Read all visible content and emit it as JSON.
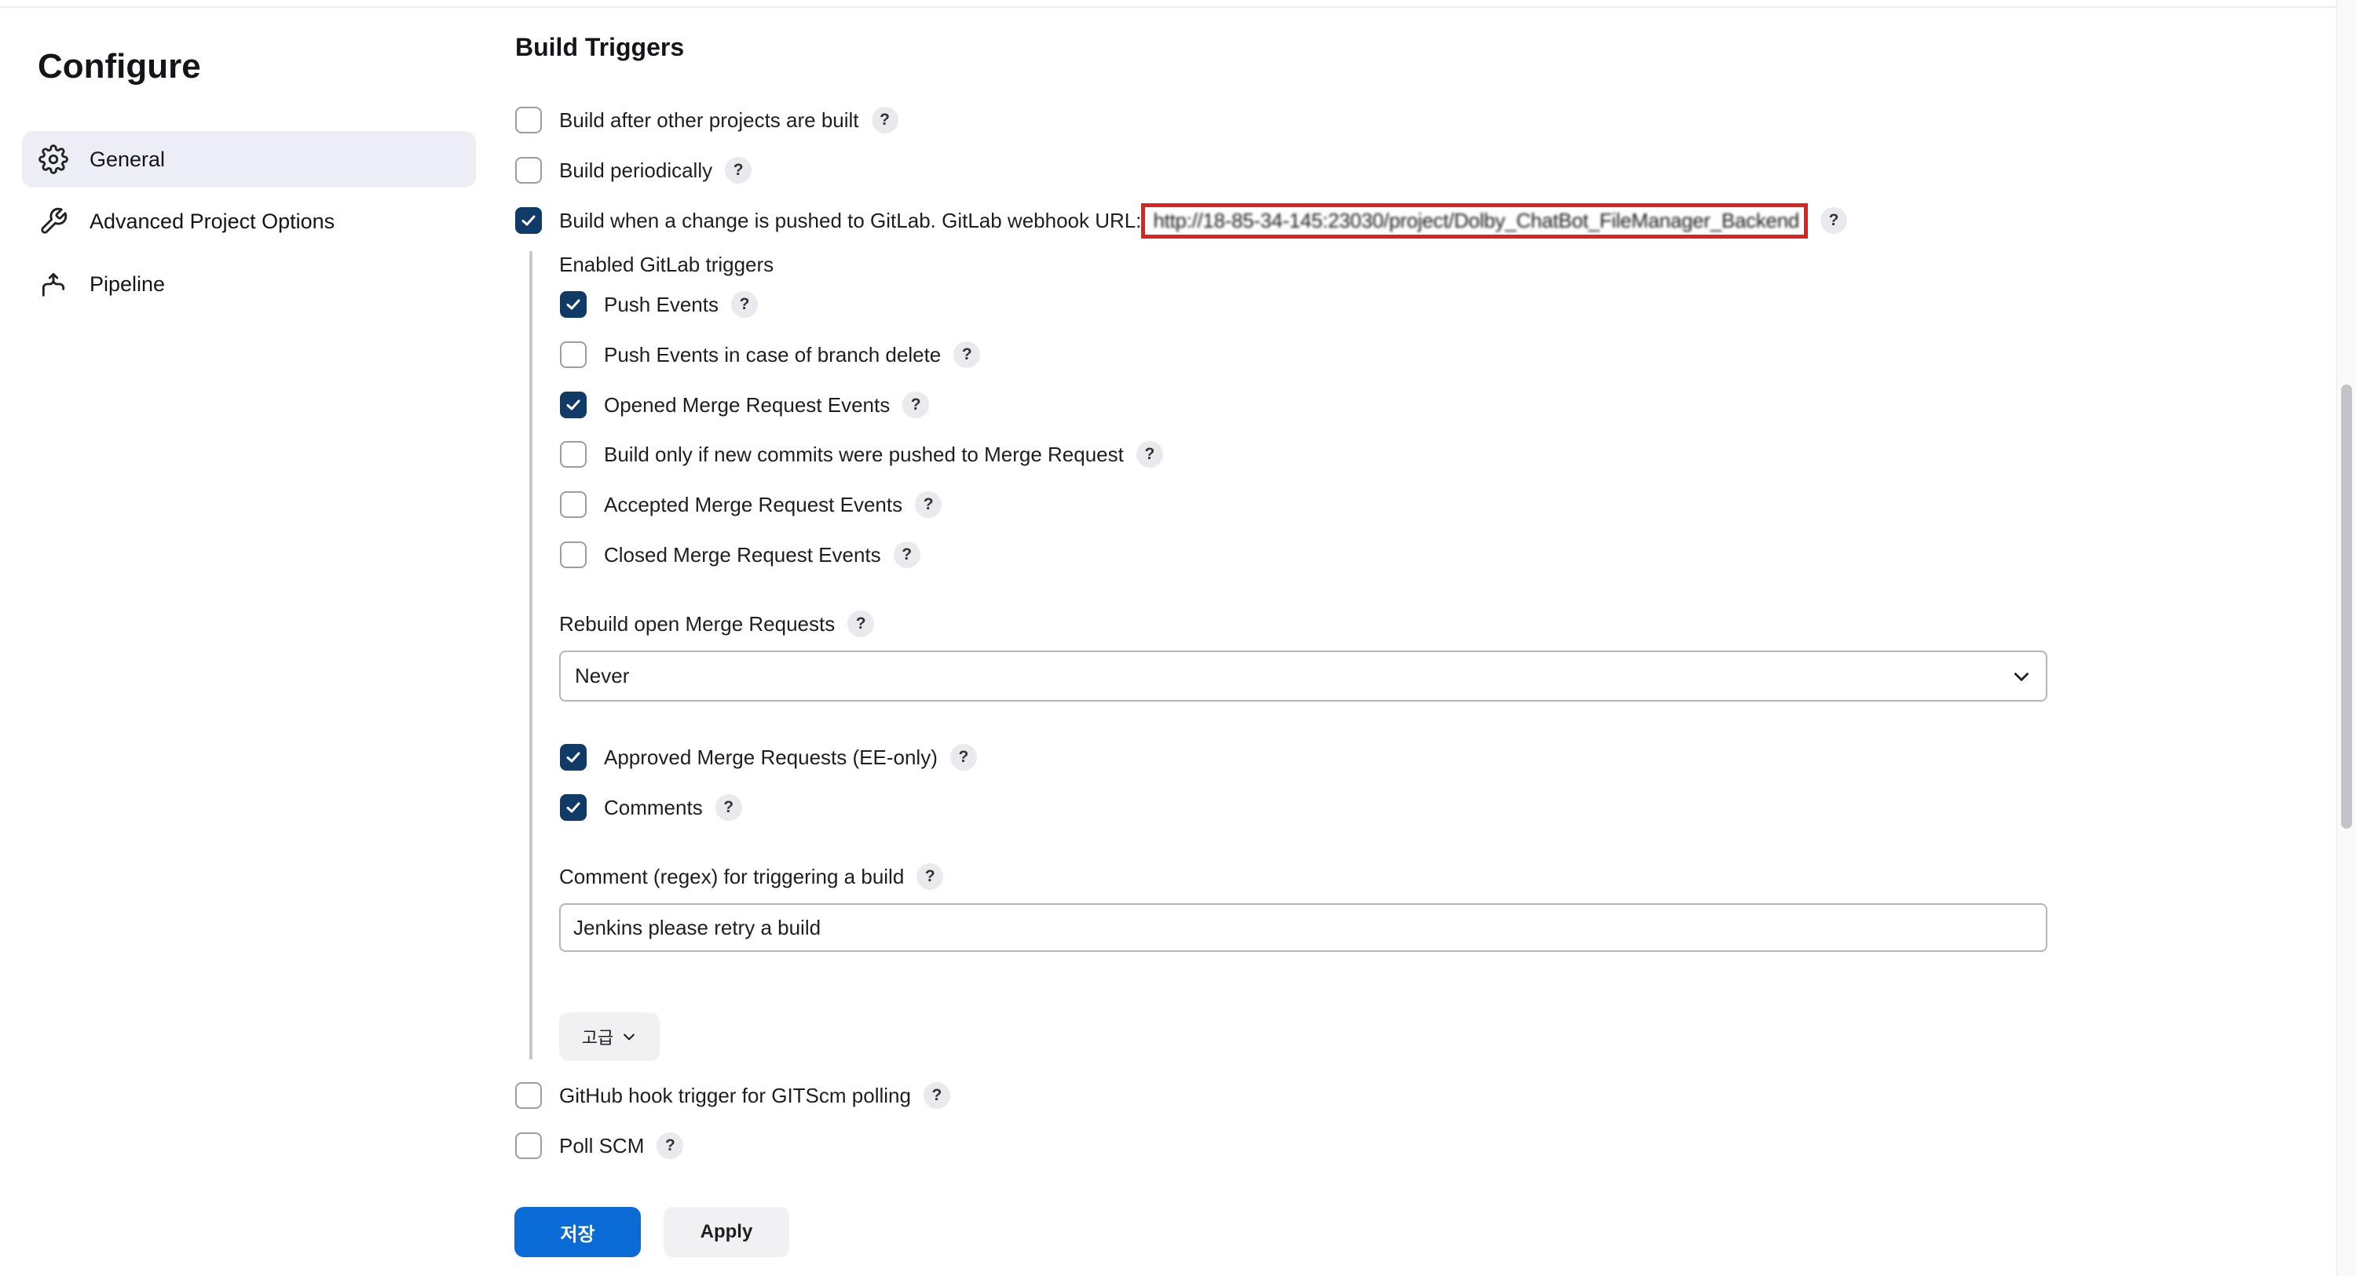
{
  "page": {
    "title": "Configure"
  },
  "sidebar": {
    "items": [
      {
        "label": "General",
        "icon": "gear-icon",
        "active": true
      },
      {
        "label": "Advanced Project Options",
        "icon": "wrench-icon",
        "active": false
      },
      {
        "label": "Pipeline",
        "icon": "pipeline-icon",
        "active": false
      }
    ]
  },
  "build_triggers": {
    "title": "Build Triggers",
    "after_other": {
      "label": "Build after other projects are built",
      "checked": false
    },
    "periodically": {
      "label": "Build periodically",
      "checked": false
    },
    "gitlab": {
      "label": "Build when a change is pushed to GitLab. GitLab webhook URL:",
      "url": "http://18-85-34-145:23030/project/Dolby_ChatBot_FileManager_Backend",
      "checked": true,
      "enabled_title": "Enabled GitLab triggers",
      "push_events": {
        "label": "Push Events",
        "checked": true
      },
      "push_branch_delete": {
        "label": "Push Events in case of branch delete",
        "checked": false
      },
      "opened_mr": {
        "label": "Opened Merge Request Events",
        "checked": true
      },
      "new_commits_mr": {
        "label": "Build only if new commits were pushed to Merge Request",
        "checked": false
      },
      "accepted_mr": {
        "label": "Accepted Merge Request Events",
        "checked": false
      },
      "closed_mr": {
        "label": "Closed Merge Request Events",
        "checked": false
      },
      "rebuild_label": "Rebuild open Merge Requests",
      "rebuild_value": "Never",
      "approved_mr": {
        "label": "Approved Merge Requests (EE-only)",
        "checked": true
      },
      "comments": {
        "label": "Comments",
        "checked": true
      },
      "comment_regex_label": "Comment (regex) for triggering a build",
      "comment_regex_value": "Jenkins please retry a build",
      "advanced_label": "고급"
    },
    "github_hook": {
      "label": "GitHub hook trigger for GITScm polling",
      "checked": false
    },
    "poll_scm": {
      "label": "Poll SCM",
      "checked": false
    }
  },
  "help_symbol": "?",
  "footer": {
    "save_label": "저장",
    "apply_label": "Apply"
  },
  "colors": {
    "primary": "#0a6bd6",
    "checkbox_checked": "#0f3b66",
    "highlight_box": "#e0221c",
    "active_nav_bg": "#ededf5"
  }
}
